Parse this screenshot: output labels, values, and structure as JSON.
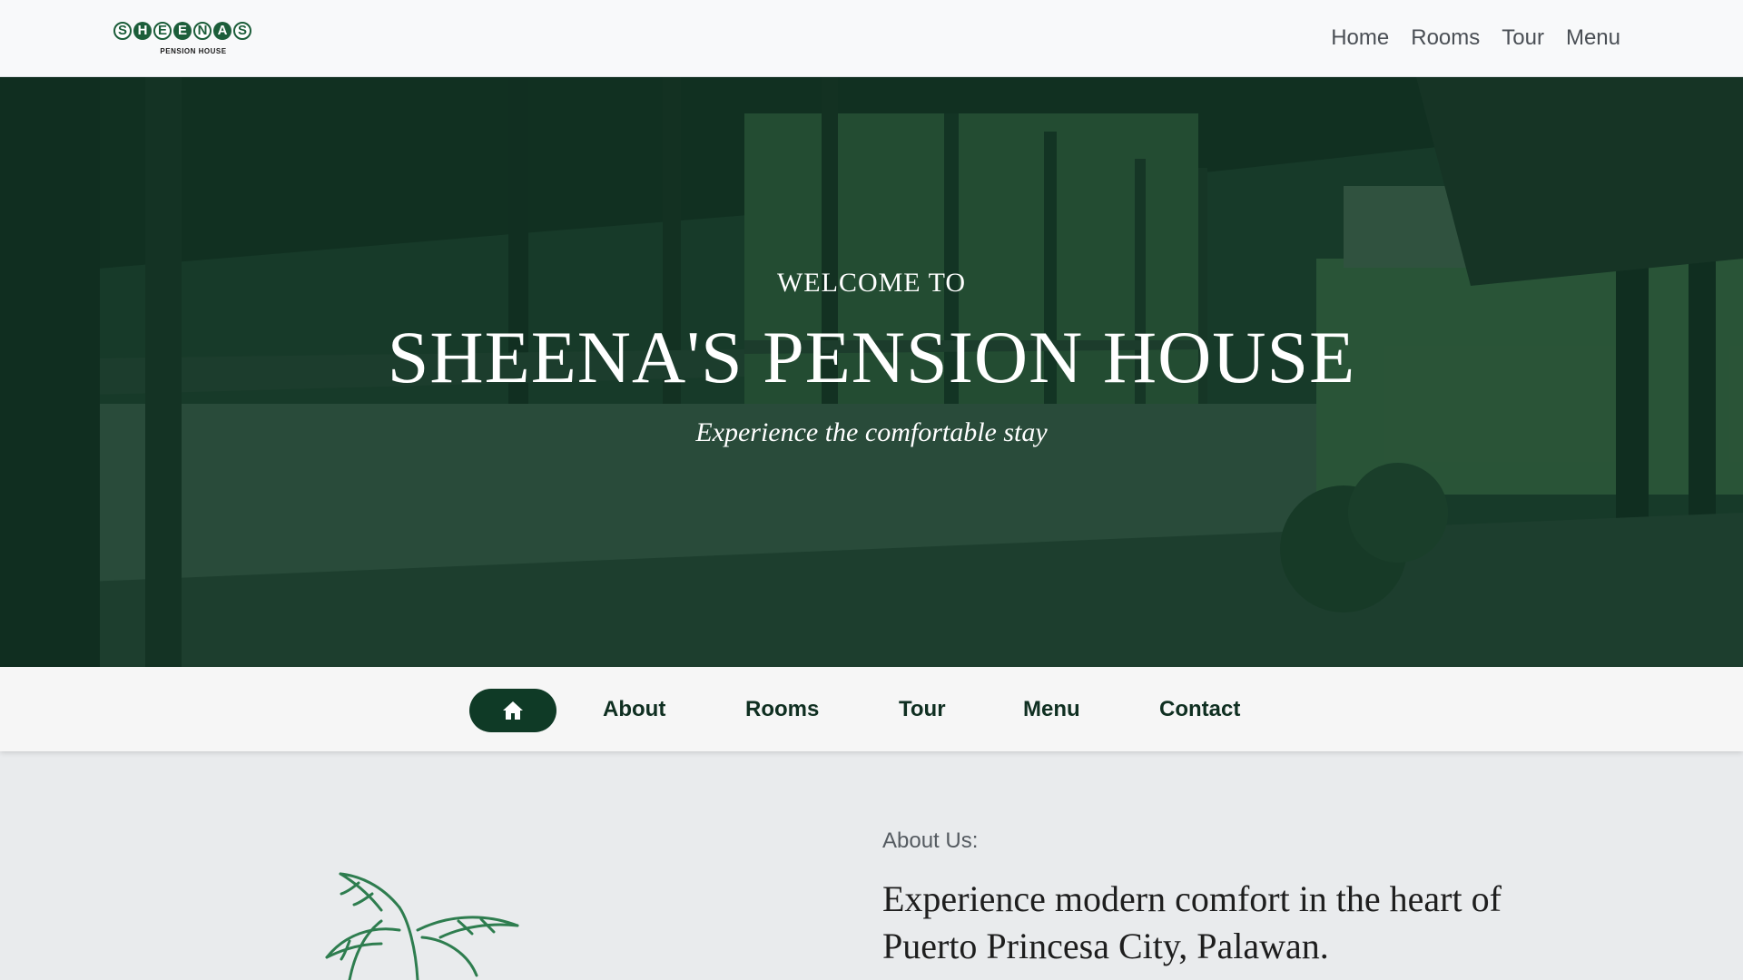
{
  "brand": {
    "logo_letters": [
      "S",
      "H",
      "E",
      "E",
      "N",
      "A",
      "S"
    ],
    "logo_subtitle": "PENSION HOUSE"
  },
  "top_nav": {
    "items": [
      {
        "label": "Home"
      },
      {
        "label": "Rooms"
      },
      {
        "label": "Tour"
      },
      {
        "label": "Menu"
      }
    ]
  },
  "hero": {
    "welcome": "WELCOME TO",
    "title": "SHEENA'S PENSION HOUSE",
    "subtitle": "Experience the comfortable stay"
  },
  "section_nav": {
    "home_icon": "home-icon",
    "items": [
      {
        "label": "About"
      },
      {
        "label": "Rooms"
      },
      {
        "label": "Tour"
      },
      {
        "label": "Menu"
      },
      {
        "label": "Contact"
      }
    ]
  },
  "about": {
    "label": "About Us:",
    "heading": "Experience modern comfort in the heart of Puerto Princesa City, Palawan.",
    "illustration_icon": "palm-tree-icon"
  },
  "colors": {
    "brand_green": "#1c5e3a",
    "dark_green": "#0f3a26",
    "hero_overlay": "#0a301e"
  }
}
